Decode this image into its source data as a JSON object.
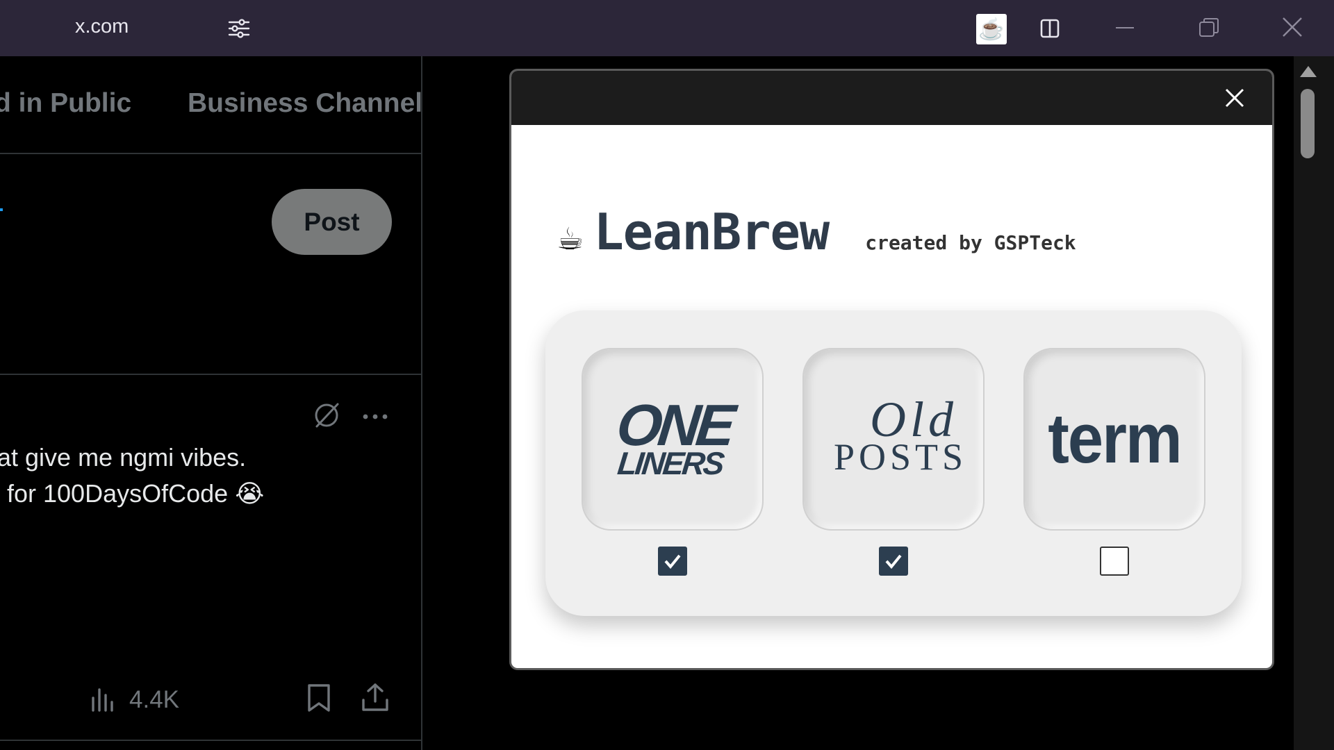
{
  "titlebar": {
    "url": "x.com",
    "icons": [
      "tune-icon",
      "coffee-extension-icon",
      "split-view-icon",
      "minimize-icon",
      "restore-icon",
      "close-icon"
    ]
  },
  "tabs": [
    {
      "label": "d in Public"
    },
    {
      "label": "Business Channel"
    }
  ],
  "compose": {
    "post_label": "Post"
  },
  "tweet": {
    "line1": "at give me ngmi vibes.",
    "line2": "for 100DaysOfCode",
    "emoji": "😭",
    "views": "4.4K",
    "icons": [
      "grok-icon",
      "more-icon",
      "views-icon",
      "bookmark-icon",
      "share-icon"
    ]
  },
  "popup": {
    "brand_cup": "☕",
    "brand_name": "LeanBrew",
    "created_by": "created by GSPTeck",
    "options": [
      {
        "line1": "ONE",
        "line2": "LINERS",
        "checked": true
      },
      {
        "line1": "Old",
        "line2": "POSTS",
        "checked": true
      },
      {
        "line1": "term",
        "checked": false
      }
    ]
  },
  "colors": {
    "titlebar_bg": "#2c2639",
    "page_bg": "#000000",
    "post_button_bg": "#787a7a",
    "brand_text": "#2c3e50",
    "card_bg": "#efefef"
  }
}
